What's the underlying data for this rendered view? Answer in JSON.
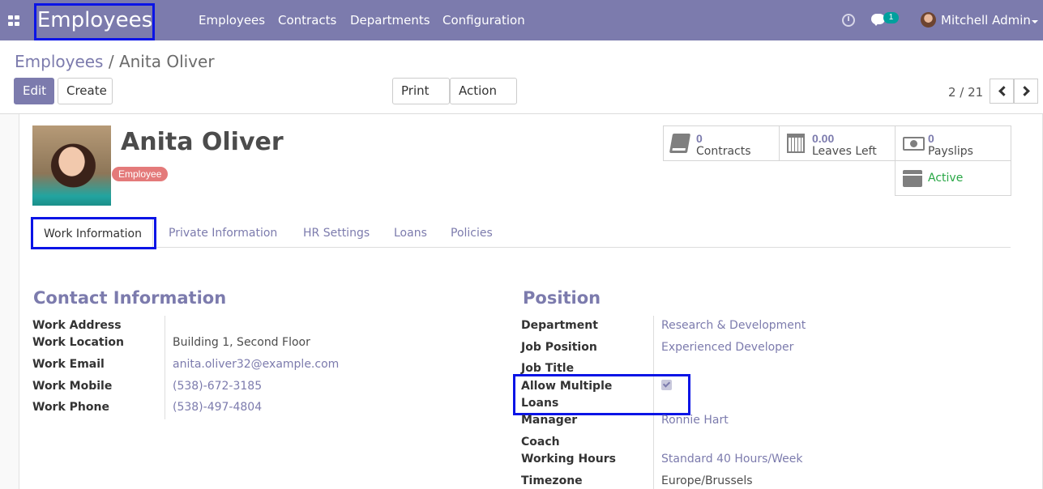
{
  "topbar": {
    "app_title": "Employees",
    "menu": [
      "Employees",
      "Contracts",
      "Departments",
      "Configuration"
    ],
    "chat_count": "1",
    "user_name": "Mitchell Admin",
    "icons": [
      "apps-grid-icon",
      "clock-icon",
      "chat-icon",
      "user-avatar"
    ]
  },
  "breadcrumb": {
    "parent": "Employees",
    "separator": "/",
    "current": "Anita Oliver"
  },
  "buttons": {
    "edit": "Edit",
    "create": "Create",
    "print": "Print",
    "action": "Action"
  },
  "pager": {
    "value": "2 / 21"
  },
  "employee": {
    "name": "Anita Oliver",
    "tag": "Employee"
  },
  "stats": {
    "contracts": {
      "value": "0",
      "label": "Contracts"
    },
    "leaves": {
      "value": "0.00",
      "label": "Leaves Left"
    },
    "payslips": {
      "value": "0",
      "label": "Payslips"
    },
    "status": {
      "label": "Active"
    }
  },
  "tabs": [
    "Work Information",
    "Private Information",
    "HR Settings",
    "Loans",
    "Policies"
  ],
  "contact": {
    "title": "Contact Information",
    "work_address_label": "Work Address",
    "work_location_label": "Work Location",
    "work_location": "Building 1, Second Floor",
    "work_email_label": "Work Email",
    "work_email": "anita.oliver32@example.com",
    "work_mobile_label": "Work Mobile",
    "work_mobile": "(538)-672-3185",
    "work_phone_label": "Work Phone",
    "work_phone": "(538)-497-4804"
  },
  "position": {
    "title": "Position",
    "department_label": "Department",
    "department": "Research & Development",
    "job_position_label": "Job Position",
    "job_position": "Experienced Developer",
    "job_title_label": "Job Title",
    "allow_loans_label_1": "Allow Multiple",
    "allow_loans_label_2": "Loans",
    "allow_loans_checked": true,
    "manager_label": "Manager",
    "manager": "Ronnie Hart",
    "coach_label": "Coach",
    "working_hours_label": "Working Hours",
    "working_hours": "Standard 40 Hours/Week",
    "timezone_label": "Timezone",
    "timezone": "Europe/Brussels"
  },
  "colors": {
    "brand": "#7c7bad",
    "highlight": "#0a14e6",
    "tag": "#e47a7a",
    "active": "#28a745"
  }
}
